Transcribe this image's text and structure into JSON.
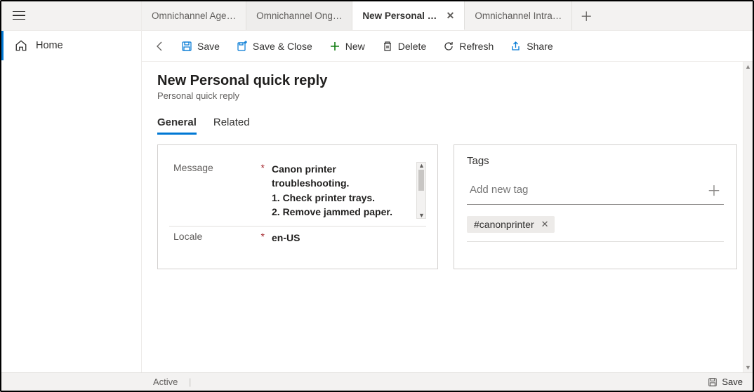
{
  "sidebar": {
    "home_label": "Home"
  },
  "tabs": [
    {
      "label": "Omnichannel Age…"
    },
    {
      "label": "Omnichannel Ong…"
    },
    {
      "label": "New Personal quick reply",
      "active": true
    },
    {
      "label": "Omnichannel Intra…"
    }
  ],
  "commands": {
    "save": "Save",
    "save_close": "Save & Close",
    "new": "New",
    "delete": "Delete",
    "refresh": "Refresh",
    "share": "Share"
  },
  "page": {
    "title": "New Personal quick reply",
    "subtitle": "Personal quick reply"
  },
  "formtabs": {
    "general": "General",
    "related": "Related"
  },
  "fields": {
    "message_label": "Message",
    "message_value": "Canon printer troubleshooting.\n1. Check printer trays.\n2. Remove jammed paper.",
    "locale_label": "Locale",
    "locale_value": "en-US"
  },
  "tags": {
    "section_title": "Tags",
    "add_placeholder": "Add new tag",
    "items": [
      "#canonprinter"
    ]
  },
  "status": {
    "state": "Active",
    "save": "Save"
  }
}
